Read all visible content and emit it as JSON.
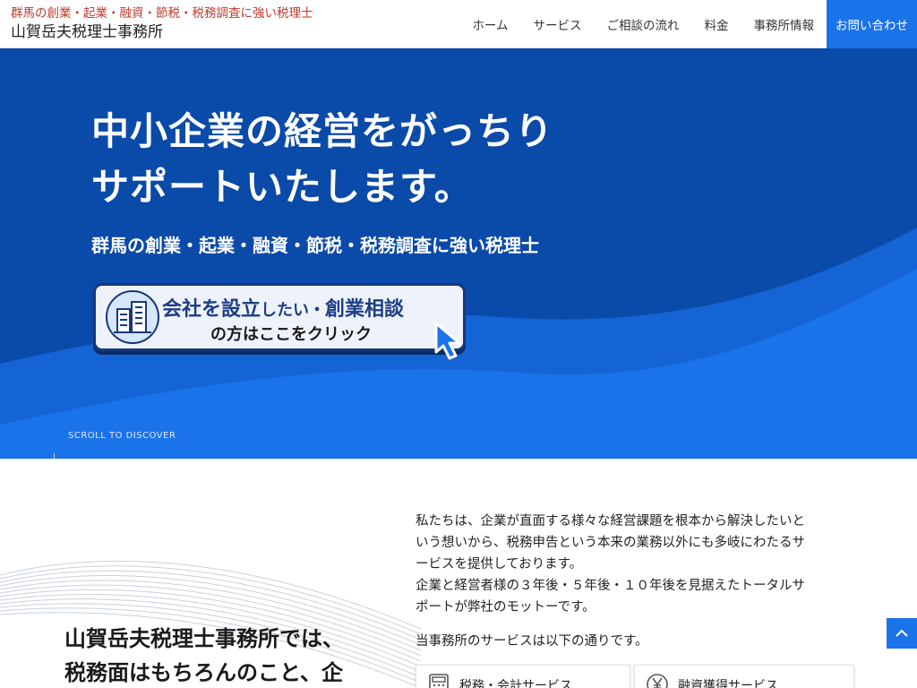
{
  "header": {
    "tagline": "群馬の創業・起業・融資・節税・税務調査に強い税理士",
    "site_name": "山賀岳夫税理士事務所",
    "nav": [
      {
        "label": "ホーム"
      },
      {
        "label": "サービス"
      },
      {
        "label": "ご相談の流れ"
      },
      {
        "label": "料金"
      },
      {
        "label": "事務所情報"
      },
      {
        "label": "お問い合わせ"
      }
    ]
  },
  "hero": {
    "title_line1": "中小企業の経営をがっちり",
    "title_line2": "サポートいたします。",
    "subtitle": "群馬の創業・起業・融資・節税・税務調査に強い税理士",
    "banner": {
      "part1": "会社を設立",
      "part2": "したい・",
      "part3": "創業相談",
      "line2": "の方はここをクリック"
    },
    "scroll_hint": "SCROLL TO DISCOVER"
  },
  "intro": {
    "heading_line1": "山賀岳夫税理士事務所では、",
    "heading_line2": "税務面はもちろんのこと、企",
    "paragraph_lines": [
      "私たちは、企業が直面する様々な経営課題を根本から解決したいと",
      "いう想いから、税務申告という本来の業務以外にも多岐にわたるサ",
      "ービスを提供しております。",
      "企業と経営者様の３年後・５年後・１０年後を見据えたトータルサ",
      "ポートが弊社のモットーです。"
    ],
    "services_note": "当事務所のサービスは以下の通りです。",
    "services": [
      {
        "label": "税務・会計サービス",
        "icon": "calculator-icon"
      },
      {
        "label": "融資獲得サービス",
        "icon": "yen-icon"
      }
    ]
  },
  "colors": {
    "hero_bg": "#0a4aa8",
    "wave": "#1a73e8",
    "accent": "#1a73e8",
    "tagline": "#c0392b"
  }
}
